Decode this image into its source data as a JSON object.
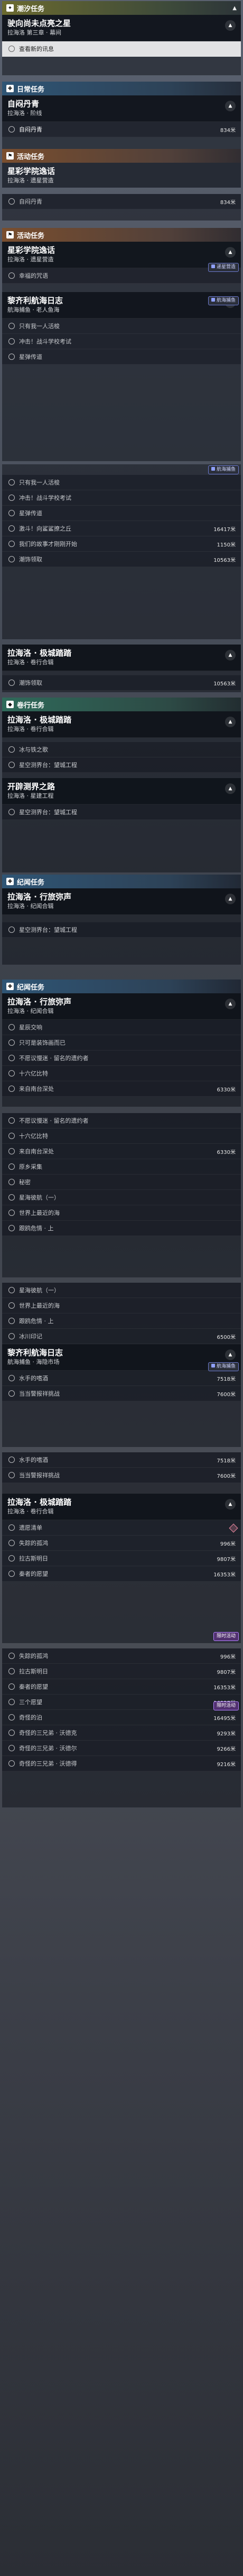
{
  "p1": {
    "cat": "潮汐任务",
    "card_title": "驶向尚未点亮之星",
    "card_sub": "拉海洛 第三章 · 幕间",
    "objectives": [
      {
        "text": "查看新的讯息",
        "dist": ""
      }
    ]
  },
  "p2": {
    "cat": "日常任务",
    "card_title": "自闷丹青",
    "card_sub": "拉海洛 · 阶线",
    "objectives": [
      {
        "text": "自闷丹青",
        "dist": "834米"
      }
    ]
  },
  "p3": {
    "cat": "活动任务",
    "card_title": "星彩学院逸话",
    "card_sub": "拉海洛 · 遗星营造",
    "objectives": [
      {
        "text": "自闷丹青",
        "dist": "834米"
      }
    ]
  },
  "p4": {
    "cat": "活动任务",
    "card_title": "星彩学院逸话",
    "card_sub": "拉海洛 · 遗星营造",
    "badge1": "递星营造",
    "objectives1": [
      {
        "text": "幸福的咒语",
        "dist": ""
      }
    ],
    "card2_title": "黎齐利航海日志",
    "card2_sub": "航海捕鱼 · 老人鱼海",
    "badge2": "航海捕鱼",
    "objectives2": [
      {
        "text": "只有我一人活梭",
        "dist": ""
      },
      {
        "text": "冲击！战斗学校考试",
        "dist": ""
      },
      {
        "text": "星弹传道",
        "dist": ""
      }
    ]
  },
  "p5": {
    "badge": "航海捕鱼",
    "objectives": [
      {
        "text": "只有我一人活梭",
        "dist": ""
      },
      {
        "text": "冲击！战斗学校考试",
        "dist": ""
      },
      {
        "text": "星弹传道",
        "dist": ""
      },
      {
        "text": "激斗！向鲨鲨撩之丘",
        "dist": "16417米"
      },
      {
        "text": "我们的故事才刚刚开始",
        "dist": "1150米"
      },
      {
        "text": "潮饰领取",
        "dist": "10563米"
      }
    ]
  },
  "p6": {
    "card_title": "拉海洛 · 极城踏踏",
    "card_sub": "拉海洛 · 卷行合辑",
    "objectives": [
      {
        "text": "潮饰领取",
        "dist": "10563米"
      }
    ]
  },
  "p7": {
    "cat": "卷行任务",
    "card_title": "拉海洛 · 极城踏踏",
    "card_sub": "拉海洛 · 卷行合辑",
    "objectives": [
      {
        "text": "冰与铁之歌",
        "dist": ""
      },
      {
        "text": "星空测界台：望城工程",
        "dist": ""
      }
    ],
    "card2_title": "开辟测界之路",
    "card2_sub": "拉海洛 · 星建工程",
    "objectives2": [
      {
        "text": "星空测界台：望城工程",
        "dist": ""
      }
    ]
  },
  "p8": {
    "cat": "纪闻任务",
    "card_title": "拉海洛 · 行旅弥声",
    "card_sub": "拉海洛 · 纪闻合辑",
    "objectives": [
      {
        "text": "星空测界台：望城工程",
        "dist": ""
      }
    ]
  },
  "p9": {
    "cat": "纪闻任务",
    "card_title": "拉海洛 · 行旅弥声",
    "card_sub": "拉海洛 · 纪闻合辑",
    "objectives": [
      {
        "text": "星辰交响",
        "dist": ""
      },
      {
        "text": "只可是装饰画而已",
        "dist": ""
      },
      {
        "text": "不愿议慢迷 · 留名的遗约者",
        "dist": ""
      },
      {
        "text": "十六亿比特",
        "dist": ""
      },
      {
        "text": "来自南台深处",
        "dist": "6330米"
      }
    ]
  },
  "p10": {
    "objectives": [
      {
        "text": "不愿议慢迷 · 留名的遗约者",
        "dist": ""
      },
      {
        "text": "十六亿比特",
        "dist": ""
      },
      {
        "text": "来自南台深处",
        "dist": "6330米"
      },
      {
        "text": "原乡采集",
        "dist": ""
      },
      {
        "text": "秘密",
        "dist": ""
      },
      {
        "text": "星海彼航（一）",
        "dist": ""
      },
      {
        "text": "世界上最近的海",
        "dist": ""
      },
      {
        "text": "跟鸥危情 · 上",
        "dist": ""
      }
    ]
  },
  "p11": {
    "objectives": [
      {
        "text": "星海彼航（一）",
        "dist": ""
      },
      {
        "text": "世界上最近的海",
        "dist": ""
      },
      {
        "text": "跟鸥危情 · 上",
        "dist": ""
      },
      {
        "text": "冰川印记",
        "dist": "6500米"
      }
    ],
    "card_title": "黎齐利航海日志",
    "card_sub": "航海捕鱼 · 海隐市场",
    "badge": "航海捕鱼",
    "objectives2": [
      {
        "text": "水手的嗜酒",
        "dist": "7518米"
      },
      {
        "text": "当当警报祥挑战",
        "dist": "7600米"
      }
    ]
  },
  "p12": {
    "objectives": [
      {
        "text": "水手的嗜酒",
        "dist": "7518米"
      },
      {
        "text": "当当警报祥挑战",
        "dist": "7600米"
      }
    ],
    "card_title": "拉海洛 · 极城踏踏",
    "card_sub": "拉海洛 · 卷行合辑",
    "badge": "限时活动",
    "objectives2": [
      {
        "text": "遗愿清单",
        "dist": ""
      },
      {
        "text": "失踪的孤鸿",
        "dist": "996米"
      },
      {
        "text": "拉古斯明日",
        "dist": "9807米"
      },
      {
        "text": "秦者的愿望",
        "dist": "16353米"
      }
    ]
  },
  "p13": {
    "badge": "限时活动",
    "objectives": [
      {
        "text": "失踪的孤鸿",
        "dist": "996米"
      },
      {
        "text": "拉古斯明日",
        "dist": "9807米"
      },
      {
        "text": "秦者的愿望",
        "dist": "16353米"
      },
      {
        "text": "三个愿望",
        "dist": "16327米"
      },
      {
        "text": "奇怪的泊",
        "dist": "16495米"
      },
      {
        "text": "奇怪的三兄弟 · 沃德克",
        "dist": "9293米"
      },
      {
        "text": "奇怪的三兄弟 · 沃德尔",
        "dist": "9266米"
      },
      {
        "text": "奇怪的三兄弟 · 沃德得",
        "dist": "9216米"
      }
    ]
  }
}
